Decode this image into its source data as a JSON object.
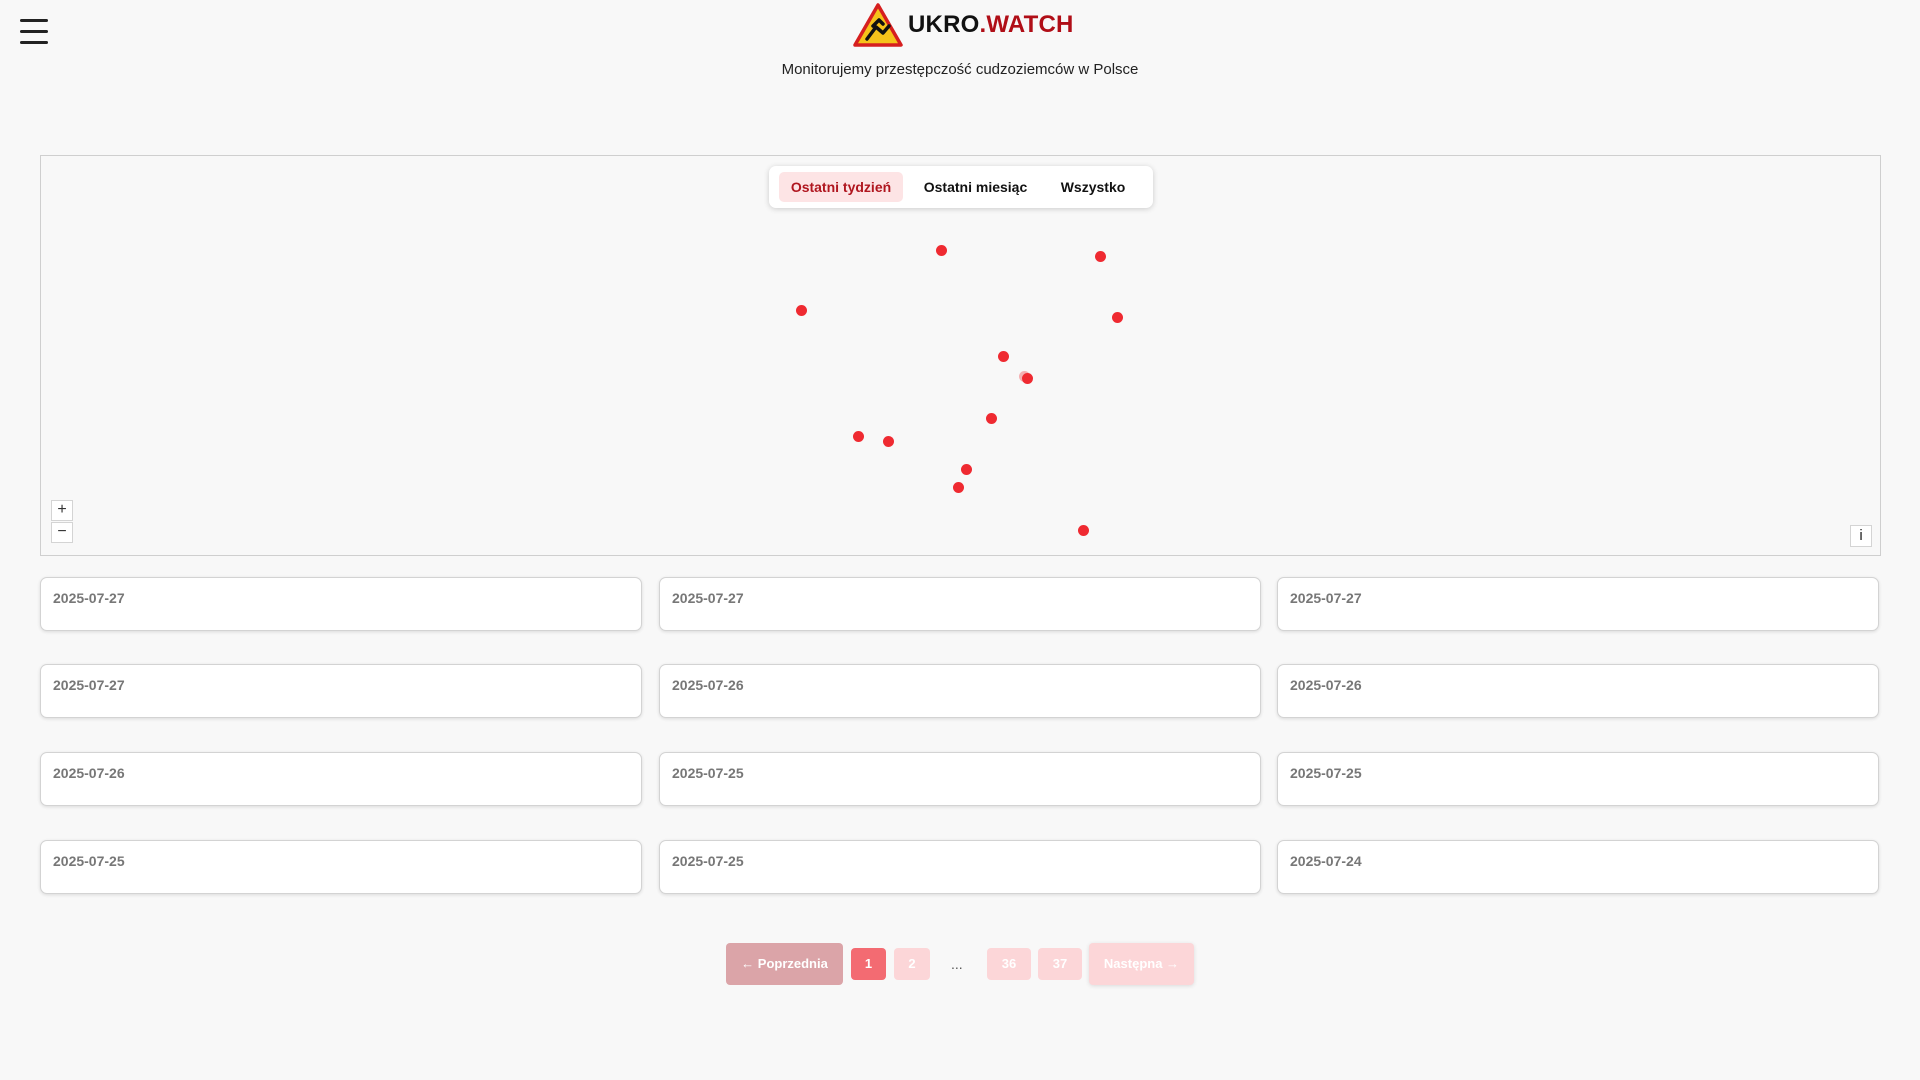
{
  "brand": {
    "name_part1": "UKRO",
    "name_part2": ".WATCH",
    "tagline": "Monitorujemy przestępczość cudzoziemców w Polsce",
    "accent_color": "#b00e17"
  },
  "menu": {
    "icon": "hamburger-menu-icon"
  },
  "map": {
    "filters": [
      {
        "label": "Ostatni tydzień",
        "active": true
      },
      {
        "label": "Ostatni miesiąc",
        "active": false
      },
      {
        "label": "Wszystko",
        "active": false
      }
    ],
    "zoom_in_label": "+",
    "zoom_out_label": "−",
    "info_label": "i",
    "marker_color": "#ef2a31",
    "marker_count": 14
  },
  "incidents": [
    {
      "date": "2025-07-27"
    },
    {
      "date": "2025-07-27"
    },
    {
      "date": "2025-07-27"
    },
    {
      "date": "2025-07-27"
    },
    {
      "date": "2025-07-26"
    },
    {
      "date": "2025-07-26"
    },
    {
      "date": "2025-07-26"
    },
    {
      "date": "2025-07-25"
    },
    {
      "date": "2025-07-25"
    },
    {
      "date": "2025-07-25"
    },
    {
      "date": "2025-07-25"
    },
    {
      "date": "2025-07-24"
    }
  ],
  "pagination": {
    "prev_label": "← Poprzednia",
    "next_label": "Następna →",
    "pages": [
      "1",
      "2",
      "36",
      "37"
    ],
    "ellipsis": "...",
    "current_page": "1"
  }
}
